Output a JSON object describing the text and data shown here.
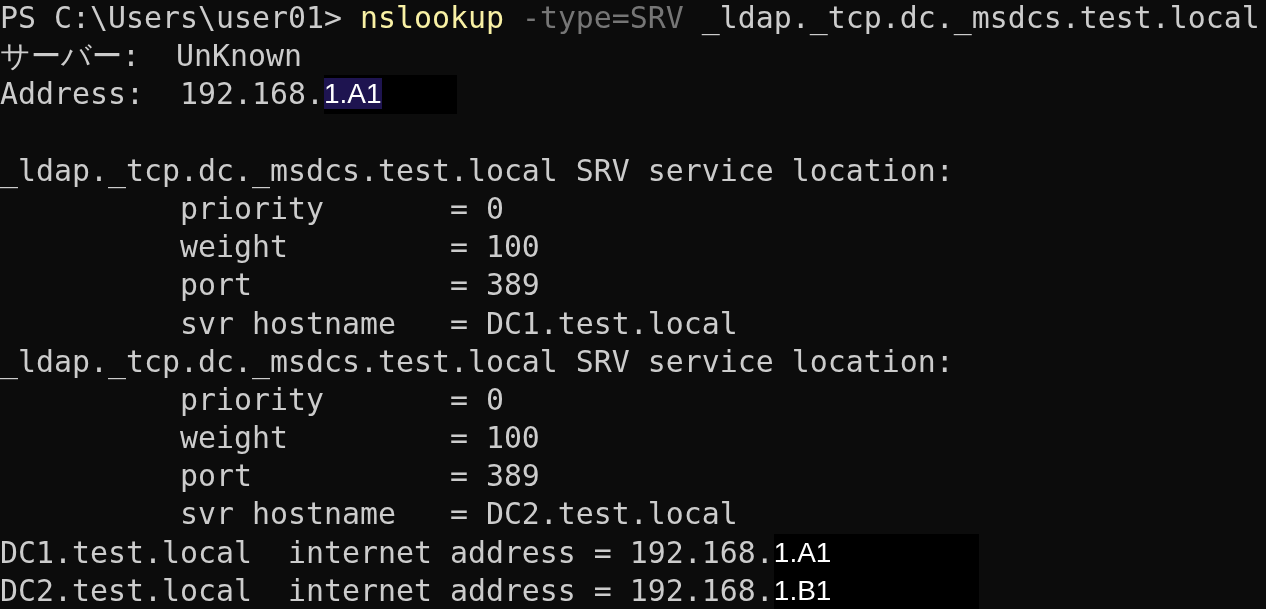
{
  "terminal": {
    "lines": [
      {
        "kind": "text",
        "segments": [
          {
            "kind": "prompt",
            "text": "PS C:\\Users\\user01> "
          },
          {
            "kind": "command",
            "text": "nslookup"
          },
          {
            "kind": "param",
            "text": " -type=SRV"
          },
          {
            "kind": "output",
            "text": " _ldap._tcp.dc._msdcs.test.local"
          }
        ]
      },
      {
        "kind": "text",
        "segments": [
          {
            "kind": "output",
            "text": "サーバー:  UnKnown"
          }
        ]
      },
      {
        "kind": "text",
        "segments": [
          {
            "kind": "output",
            "text": "Address:  192.168."
          },
          {
            "kind": "redacted",
            "text": "1.A1",
            "selected": true
          }
        ]
      },
      {
        "kind": "blank"
      },
      {
        "kind": "text",
        "segments": [
          {
            "kind": "output",
            "text": "_ldap._tcp.dc._msdcs.test.local SRV service location:"
          }
        ]
      },
      {
        "kind": "text",
        "segments": [
          {
            "kind": "output",
            "text": "          priority       = 0"
          }
        ]
      },
      {
        "kind": "text",
        "segments": [
          {
            "kind": "output",
            "text": "          weight         = 100"
          }
        ]
      },
      {
        "kind": "text",
        "segments": [
          {
            "kind": "output",
            "text": "          port           = 389"
          }
        ]
      },
      {
        "kind": "text",
        "segments": [
          {
            "kind": "output",
            "text": "          svr hostname   = DC1.test.local"
          }
        ]
      },
      {
        "kind": "text",
        "segments": [
          {
            "kind": "output",
            "text": "_ldap._tcp.dc._msdcs.test.local SRV service location:"
          }
        ]
      },
      {
        "kind": "text",
        "segments": [
          {
            "kind": "output",
            "text": "          priority       = 0"
          }
        ]
      },
      {
        "kind": "text",
        "segments": [
          {
            "kind": "output",
            "text": "          weight         = 100"
          }
        ]
      },
      {
        "kind": "text",
        "segments": [
          {
            "kind": "output",
            "text": "          port           = 389"
          }
        ]
      },
      {
        "kind": "text",
        "segments": [
          {
            "kind": "output",
            "text": "          svr hostname   = DC2.test.local"
          }
        ]
      },
      {
        "kind": "text",
        "segments": [
          {
            "kind": "output",
            "text": "DC1.test.local  internet address = 192.168."
          },
          {
            "kind": "redacted",
            "text": "1.A1",
            "selected": false
          }
        ]
      },
      {
        "kind": "text",
        "segments": [
          {
            "kind": "output",
            "text": "DC2.test.local  internet address = 192.168."
          },
          {
            "kind": "redacted",
            "text": "1.B1",
            "selected": false
          }
        ]
      }
    ]
  }
}
